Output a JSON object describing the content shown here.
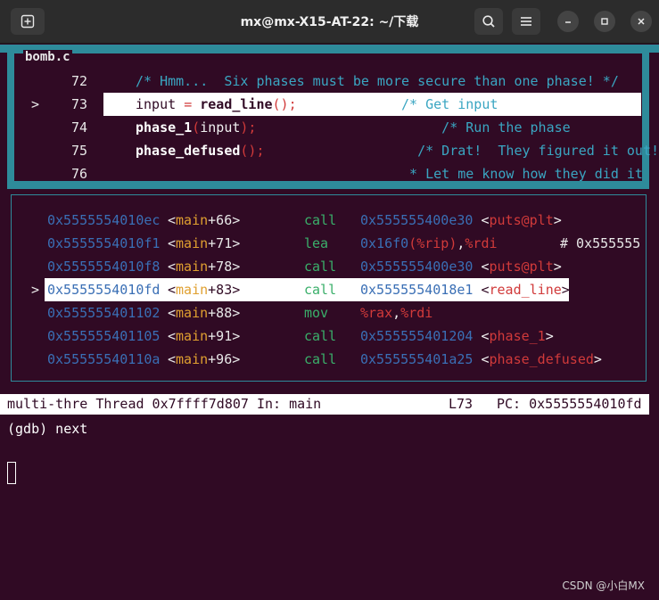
{
  "window": {
    "title": "mx@mx-X15-AT-22: ~/下载"
  },
  "source": {
    "filename": "bomb.c",
    "lines": [
      {
        "marker": "",
        "num": "72",
        "segs": [
          {
            "t": "/* Hmm...  Six phases must be more secure than one phase! */",
            "c": "cyan"
          }
        ]
      },
      {
        "marker": ">",
        "num": "73",
        "segs": [
          {
            "t": "input ",
            "c": "default"
          },
          {
            "t": "= ",
            "c": "red"
          },
          {
            "t": "read_line",
            "c": "bold"
          },
          {
            "t": "();",
            "c": "red"
          },
          {
            "t": "             /* Get input",
            "c": "cyan"
          }
        ]
      },
      {
        "marker": "",
        "num": "74",
        "segs": [
          {
            "t": "phase_1",
            "c": "bold"
          },
          {
            "t": "(",
            "c": "red"
          },
          {
            "t": "input",
            "c": "default"
          },
          {
            "t": ");",
            "c": "red"
          },
          {
            "t": "                       /* Run the phase",
            "c": "cyan"
          }
        ]
      },
      {
        "marker": "",
        "num": "75",
        "segs": [
          {
            "t": "phase_defused",
            "c": "bold"
          },
          {
            "t": "();",
            "c": "red"
          },
          {
            "t": "                   /* Drat!  They figured it out!",
            "c": "cyan"
          }
        ]
      },
      {
        "marker": "",
        "num": "76",
        "segs": [
          {
            "t": "                                  * Let me know how they did it",
            "c": "cyan"
          }
        ]
      }
    ]
  },
  "assembly": [
    {
      "marker": "",
      "addr": "0x5555554010ec",
      "sym": "<main+66>",
      "op": "call",
      "args": [
        {
          "t": "0x555555400e30 ",
          "c": "blue"
        },
        {
          "t": "<",
          "c": "default"
        },
        {
          "t": "puts@plt",
          "c": "red"
        },
        {
          "t": ">",
          "c": "default"
        }
      ],
      "comment": ""
    },
    {
      "marker": "",
      "addr": "0x5555554010f1",
      "sym": "<main+71>",
      "op": "lea",
      "args": [
        {
          "t": "0x16f0",
          "c": "blue"
        },
        {
          "t": "(%rip)",
          "c": "red"
        },
        {
          "t": ",",
          "c": "default"
        },
        {
          "t": "%rdi",
          "c": "red"
        }
      ],
      "comment": "# 0x555555"
    },
    {
      "marker": "",
      "addr": "0x5555554010f8",
      "sym": "<main+78>",
      "op": "call",
      "args": [
        {
          "t": "0x555555400e30 ",
          "c": "blue"
        },
        {
          "t": "<",
          "c": "default"
        },
        {
          "t": "puts@plt",
          "c": "red"
        },
        {
          "t": ">",
          "c": "default"
        }
      ],
      "comment": ""
    },
    {
      "marker": ">",
      "addr": "0x5555554010fd",
      "sym": "<main+83>",
      "op": "call",
      "args": [
        {
          "t": "0x5555554018e1 ",
          "c": "blue"
        },
        {
          "t": "<",
          "c": "default"
        },
        {
          "t": "read_line",
          "c": "red"
        },
        {
          "t": ">",
          "c": "default"
        }
      ],
      "comment": ""
    },
    {
      "marker": "",
      "addr": "0x555555401102",
      "sym": "<main+88>",
      "op": "mov",
      "args": [
        {
          "t": "%rax",
          "c": "red"
        },
        {
          "t": ",",
          "c": "default"
        },
        {
          "t": "%rdi",
          "c": "red"
        }
      ],
      "comment": ""
    },
    {
      "marker": "",
      "addr": "0x555555401105",
      "sym": "<main+91>",
      "op": "call",
      "args": [
        {
          "t": "0x555555401204 ",
          "c": "blue"
        },
        {
          "t": "<",
          "c": "default"
        },
        {
          "t": "phase_1",
          "c": "red"
        },
        {
          "t": ">",
          "c": "default"
        }
      ],
      "comment": ""
    },
    {
      "marker": "",
      "addr": "0x55555540110a",
      "sym": "<main+96>",
      "op": "call",
      "args": [
        {
          "t": "0x555555401a25 ",
          "c": "blue"
        },
        {
          "t": "<",
          "c": "default"
        },
        {
          "t": "phase_defused",
          "c": "red"
        },
        {
          "t": ">",
          "c": "default"
        }
      ],
      "comment": ""
    }
  ],
  "status": {
    "thread": "multi-thre Thread 0x7ffff7d807 In: main",
    "line": "L73",
    "pc": "PC: 0x5555554010fd"
  },
  "prompt": "(gdb) next",
  "watermark": "CSDN @小白MX",
  "colors": {
    "background": "#300a24",
    "teal": "#2e8b9b",
    "titlebar": "#2c2c2c"
  }
}
